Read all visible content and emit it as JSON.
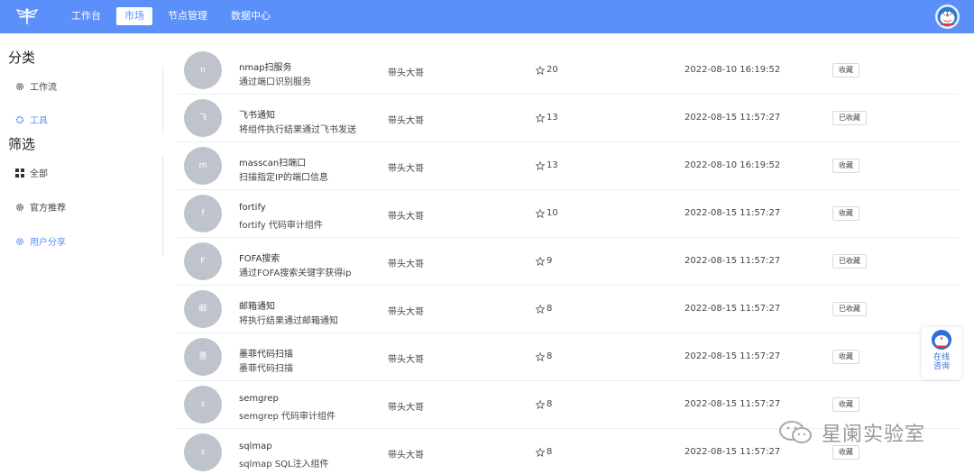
{
  "header": {
    "nav": [
      {
        "label": "工作台",
        "active": false
      },
      {
        "label": "市场",
        "active": true
      },
      {
        "label": "节点管理",
        "active": false
      },
      {
        "label": "数据中心",
        "active": false
      }
    ],
    "brand_color": "#5b8ff9"
  },
  "sidebar": {
    "category_title": "分类",
    "categories": [
      {
        "label": "工作流",
        "icon": "gear-icon",
        "active": false
      },
      {
        "label": "工具",
        "icon": "gear-icon",
        "active": true
      }
    ],
    "filter_title": "筛选",
    "filters": [
      {
        "label": "全部",
        "icon": "grid-icon",
        "active": false
      },
      {
        "label": "官方推荐",
        "icon": "gear-icon",
        "active": false
      },
      {
        "label": "用户分享",
        "icon": "gear-icon",
        "active": true
      }
    ]
  },
  "list": [
    {
      "avatar": "n",
      "name": "nmap扫服务",
      "desc": "通过端口识别服务",
      "author": "带头大哥",
      "stars": "20",
      "time": "2022-08-10 16:19:52",
      "action": "收藏"
    },
    {
      "avatar": "飞",
      "name": "飞书通知",
      "desc": "将组件执行结果通过飞书发送",
      "author": "带头大哥",
      "stars": "13",
      "time": "2022-08-15 11:57:27",
      "action": "已收藏"
    },
    {
      "avatar": "m",
      "name": "masscan扫端口",
      "desc": "扫描指定IP的端口信息",
      "author": "带头大哥",
      "stars": "13",
      "time": "2022-08-10 16:19:52",
      "action": "收藏"
    },
    {
      "avatar": "f",
      "name": "fortify",
      "desc": "fortify 代码审计组件",
      "author": "带头大哥",
      "stars": "10",
      "time": "2022-08-15 11:57:27",
      "action": "收藏"
    },
    {
      "avatar": "F",
      "name": "FOFA搜索",
      "desc": "通过FOFA搜索关键字获得ip",
      "author": "带头大哥",
      "stars": "9",
      "time": "2022-08-15 11:57:27",
      "action": "已收藏"
    },
    {
      "avatar": "邮",
      "name": "邮箱通知",
      "desc": "将执行结果通过邮箱通知",
      "author": "带头大哥",
      "stars": "8",
      "time": "2022-08-15 11:57:27",
      "action": "已收藏"
    },
    {
      "avatar": "墨",
      "name": "墨菲代码扫描",
      "desc": "墨菲代码扫描",
      "author": "带头大哥",
      "stars": "8",
      "time": "2022-08-15 11:57:27",
      "action": "收藏"
    },
    {
      "avatar": "s",
      "name": "semgrep",
      "desc": "semgrep 代码审计组件",
      "author": "带头大哥",
      "stars": "8",
      "time": "2022-08-15 11:57:27",
      "action": "收藏"
    },
    {
      "avatar": "s",
      "name": "sqlmap",
      "desc": "sqlmap SQL注入组件",
      "author": "带头大哥",
      "stars": "8",
      "time": "2022-08-15 11:57:27",
      "action": "收藏"
    }
  ],
  "consult": {
    "line1": "在线",
    "line2": "咨询"
  },
  "watermark": {
    "text": "星阑实验室"
  }
}
